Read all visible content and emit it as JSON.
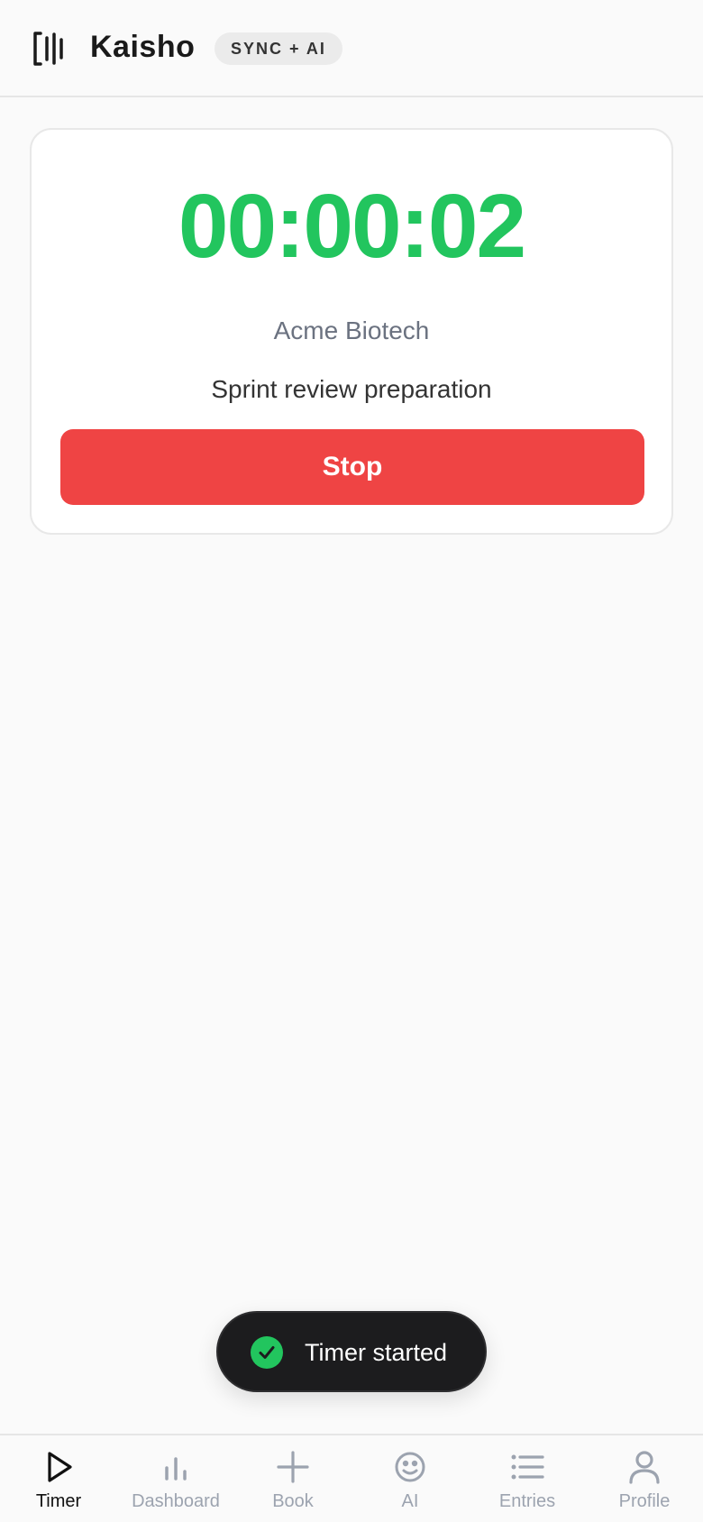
{
  "header": {
    "title": "Kaisho",
    "badge": "SYNC + AI",
    "logo_icon": "kaisho-logo-icon"
  },
  "timer_card": {
    "elapsed": "00:00:02",
    "client": "Acme Biotech",
    "task": "Sprint review preparation",
    "stop_label": "Stop"
  },
  "toast": {
    "message": "Timer started",
    "icon": "check-circle-icon"
  },
  "nav": {
    "items": [
      {
        "label": "Timer",
        "icon": "play-icon",
        "active": true
      },
      {
        "label": "Dashboard",
        "icon": "bar-chart-icon",
        "active": false
      },
      {
        "label": "Book",
        "icon": "plus-icon",
        "active": false
      },
      {
        "label": "AI",
        "icon": "smiley-icon",
        "active": false
      },
      {
        "label": "Entries",
        "icon": "list-icon",
        "active": false
      },
      {
        "label": "Profile",
        "icon": "user-icon",
        "active": false
      }
    ]
  },
  "colors": {
    "timer_green": "#22c55e",
    "stop_red": "#ef4444",
    "toast_bg": "#1c1c1e",
    "nav_active": "#111111",
    "nav_inactive": "#9ca3af"
  }
}
